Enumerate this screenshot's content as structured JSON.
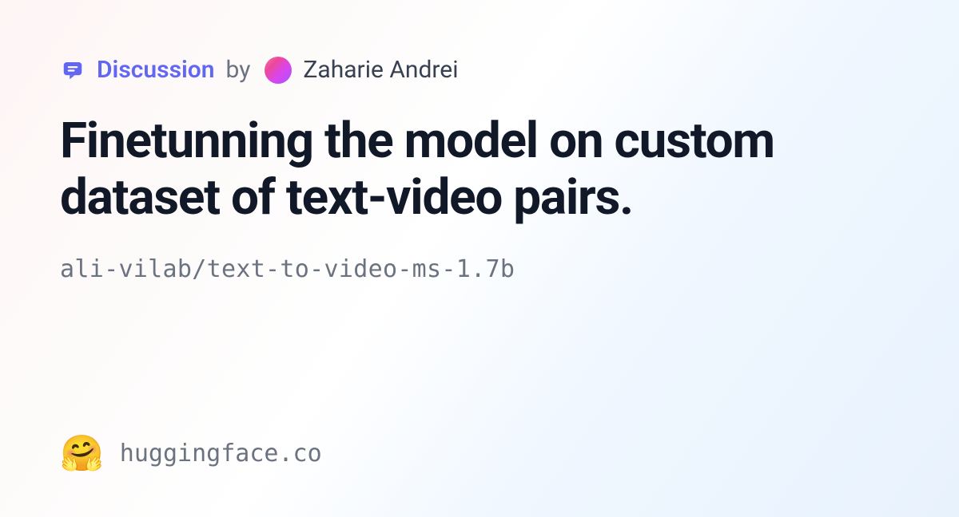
{
  "meta": {
    "discussion_label": "Discussion",
    "by_text": "by",
    "author_name": "Zaharie Andrei"
  },
  "title": "Finetunning the model on custom dataset of text-video pairs.",
  "repo_path": "ali-vilab/text-to-video-ms-1.7b",
  "footer": {
    "emoji": "🤗",
    "site": "huggingface.co"
  }
}
